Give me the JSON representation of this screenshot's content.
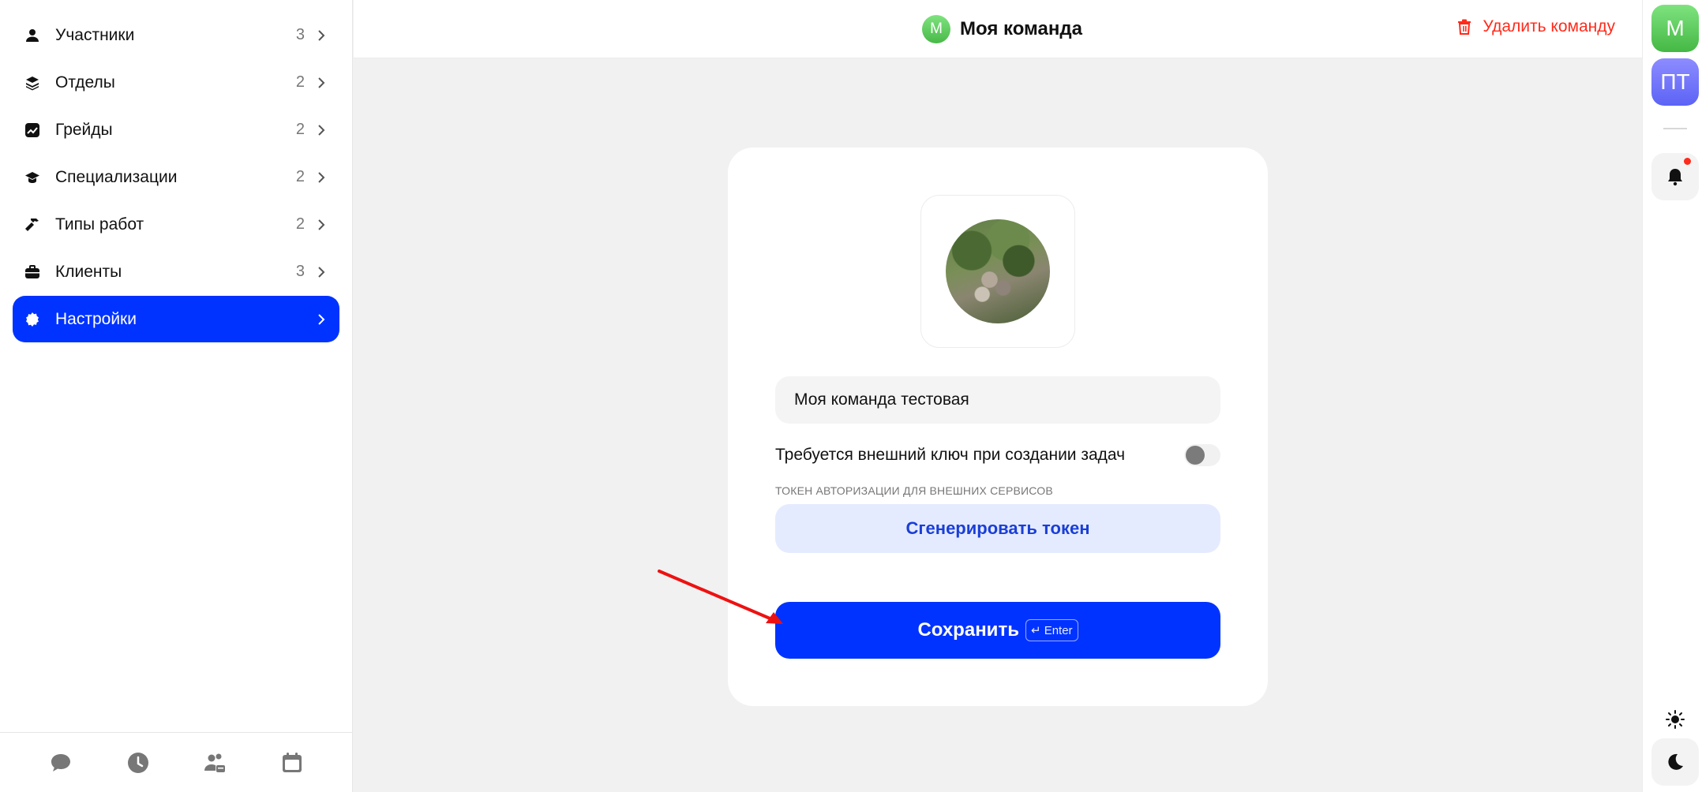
{
  "sidebar": {
    "items": [
      {
        "label": "Участники",
        "count": "3",
        "icon": "user-icon"
      },
      {
        "label": "Отделы",
        "count": "2",
        "icon": "layers-icon"
      },
      {
        "label": "Грейды",
        "count": "2",
        "icon": "chart-icon"
      },
      {
        "label": "Специализации",
        "count": "2",
        "icon": "graduation-cap-icon"
      },
      {
        "label": "Типы работ",
        "count": "2",
        "icon": "hammer-icon"
      },
      {
        "label": "Клиенты",
        "count": "3",
        "icon": "briefcase-icon"
      },
      {
        "label": "Настройки",
        "count": "",
        "icon": "gear-icon",
        "active": true
      }
    ],
    "bottom_icons": [
      "chat-icon",
      "clock-icon",
      "team-icon",
      "calendar-icon"
    ]
  },
  "header": {
    "avatar_letter": "М",
    "title": "Моя команда",
    "delete_label": "Удалить команду"
  },
  "rail": {
    "avatars": [
      "М",
      "ПТ"
    ],
    "icons": [
      "bell-icon",
      "sun-icon",
      "moon-icon"
    ]
  },
  "form": {
    "team_name_value": "Моя команда тестовая",
    "external_key_label": "Требуется внешний ключ при создании задач",
    "external_key_enabled": false,
    "token_caption": "ТОКЕН АВТОРИЗАЦИИ ДЛЯ ВНЕШНИХ СЕРВИСОВ",
    "generate_token_label": "Сгенерировать токен",
    "save_label": "Сохранить",
    "save_shortcut": "↵ Enter"
  },
  "colors": {
    "accent": "#0033ff",
    "danger": "#ff2a1a",
    "token_button_bg": "#e5ebff",
    "avatar_green": "#5ccc5c",
    "avatar_violet": "#6c6ff8"
  }
}
